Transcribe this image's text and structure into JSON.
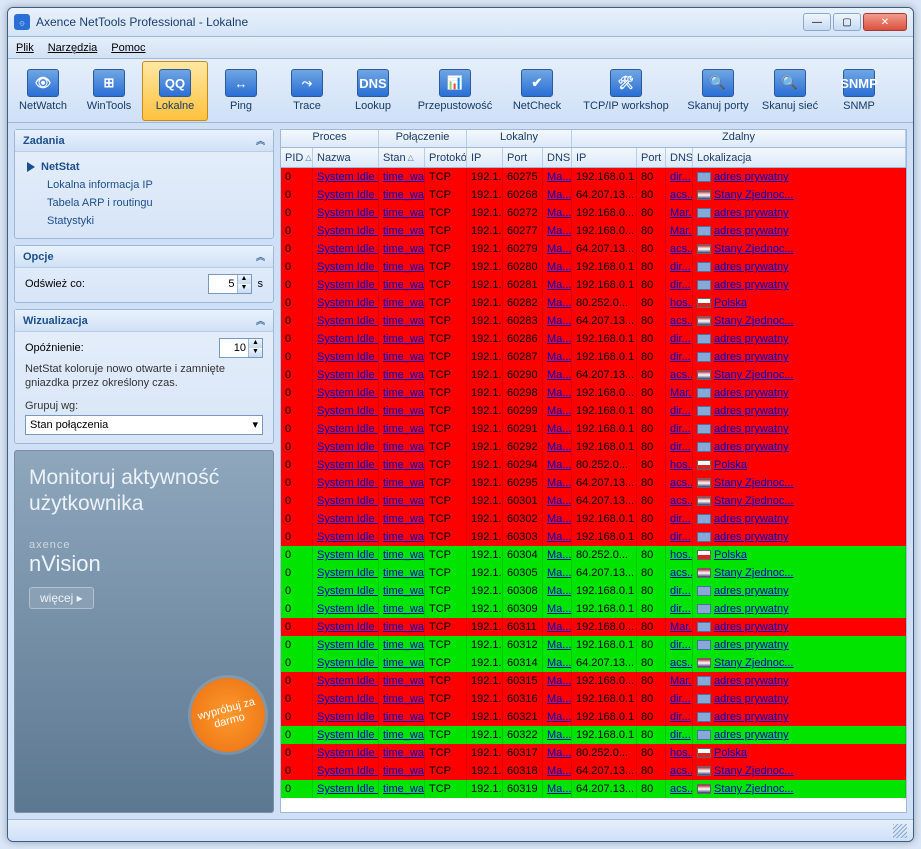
{
  "window_title": "Axence NetTools Professional - Lokalne",
  "menu": [
    "Plik",
    "Narzędzia",
    "Pomoc"
  ],
  "toolbar": [
    {
      "label": "NetWatch",
      "icon": "👁"
    },
    {
      "label": "WinTools",
      "icon": "⊞"
    },
    {
      "label": "Lokalne",
      "icon": "QQ",
      "selected": true
    },
    {
      "label": "Ping",
      "icon": "↔"
    },
    {
      "label": "Trace",
      "icon": "⤳"
    },
    {
      "label": "Lookup",
      "icon": "DNS"
    },
    {
      "label": "Przepustowość",
      "icon": "📊",
      "wide": true
    },
    {
      "label": "NetCheck",
      "icon": "✔"
    },
    {
      "label": "TCP/IP workshop",
      "icon": "🛠",
      "wider": true
    },
    {
      "label": "Skanuj porty",
      "icon": "🔍",
      "nar": true
    },
    {
      "label": "Skanuj sieć",
      "icon": "🔍",
      "nar": true
    },
    {
      "label": "SNMP",
      "icon": "SNMP"
    }
  ],
  "panels": {
    "tasks": {
      "title": "Zadania",
      "items": [
        {
          "label": "NetStat",
          "selected": true
        },
        {
          "label": "Lokalna informacja IP"
        },
        {
          "label": "Tabela ARP i routingu"
        },
        {
          "label": "Statystyki"
        }
      ]
    },
    "options": {
      "title": "Opcje",
      "refresh_label": "Odśwież co:",
      "refresh_value": "5",
      "unit": "s"
    },
    "viz": {
      "title": "Wizualizacja",
      "delay_label": "Opóźnienie:",
      "delay_value": "10",
      "note": "NetStat koloruje nowo otwarte i zamnięte gniazdka przez określony czas.",
      "group_label": "Grupuj wg:",
      "group_value": "Stan połączenia"
    }
  },
  "promo": {
    "heading": "Monitoruj aktywność użytkownika",
    "brand_small": "axence",
    "brand": "nVision",
    "more": "więcej ▸",
    "burst": "wypróbuj za darmo"
  },
  "groups": [
    "Proces",
    "Połączenie",
    "Lokalny",
    "Zdalny"
  ],
  "columns": [
    "PID",
    "Nazwa",
    "Stan",
    "Protokó",
    "IP",
    "Port",
    "DNS",
    "IP",
    "Port",
    "DNS",
    "Lokalizacja"
  ],
  "loc": {
    "priv": "adres prywatny",
    "us": "Stany Zjednoc...",
    "pl": "Polska"
  },
  "rows": [
    {
      "c": "r",
      "port": "60275",
      "rip": "192.168.0.1",
      "rdns": "dir...",
      "loc": "priv"
    },
    {
      "c": "r",
      "port": "60268",
      "rip": "64.207.13...",
      "rdns": "acs...",
      "loc": "us"
    },
    {
      "c": "r",
      "port": "60272",
      "rip": "192.168.0...",
      "rdns": "Mar...",
      "loc": "priv"
    },
    {
      "c": "r",
      "port": "60277",
      "rip": "192.168.0...",
      "rdns": "Mar...",
      "loc": "priv"
    },
    {
      "c": "r",
      "port": "60279",
      "rip": "64.207.13...",
      "rdns": "acs...",
      "loc": "us"
    },
    {
      "c": "r",
      "port": "60280",
      "rip": "192.168.0.1",
      "rdns": "dir...",
      "loc": "priv"
    },
    {
      "c": "r",
      "port": "60281",
      "rip": "192.168.0.1",
      "rdns": "dir...",
      "loc": "priv"
    },
    {
      "c": "r",
      "port": "60282",
      "rip": "80.252.0...",
      "rdns": "hos...",
      "loc": "pl"
    },
    {
      "c": "r",
      "port": "60283",
      "rip": "64.207.13...",
      "rdns": "acs...",
      "loc": "us"
    },
    {
      "c": "r",
      "port": "60286",
      "rip": "192.168.0.1",
      "rdns": "dir...",
      "loc": "priv"
    },
    {
      "c": "r",
      "port": "60287",
      "rip": "192.168.0.1",
      "rdns": "dir...",
      "loc": "priv"
    },
    {
      "c": "r",
      "port": "60290",
      "rip": "64.207.13...",
      "rdns": "acs...",
      "loc": "us"
    },
    {
      "c": "r",
      "port": "60298",
      "rip": "192.168.0...",
      "rdns": "Mar...",
      "loc": "priv"
    },
    {
      "c": "r",
      "port": "60299",
      "rip": "192.168.0.1",
      "rdns": "dir...",
      "loc": "priv"
    },
    {
      "c": "r",
      "port": "60291",
      "rip": "192.168.0.1",
      "rdns": "dir...",
      "loc": "priv"
    },
    {
      "c": "r",
      "port": "60292",
      "rip": "192.168.0.1",
      "rdns": "dir...",
      "loc": "priv"
    },
    {
      "c": "r",
      "port": "60294",
      "rip": "80.252.0...",
      "rdns": "hos...",
      "loc": "pl"
    },
    {
      "c": "r",
      "port": "60295",
      "rip": "64.207.13...",
      "rdns": "acs...",
      "loc": "us"
    },
    {
      "c": "r",
      "port": "60301",
      "rip": "64.207.13...",
      "rdns": "acs...",
      "loc": "us"
    },
    {
      "c": "r",
      "port": "60302",
      "rip": "192.168.0.1",
      "rdns": "dir...",
      "loc": "priv"
    },
    {
      "c": "r",
      "port": "60303",
      "rip": "192.168.0.1",
      "rdns": "dir...",
      "loc": "priv"
    },
    {
      "c": "g",
      "port": "60304",
      "rip": "80.252.0...",
      "rdns": "hos...",
      "loc": "pl"
    },
    {
      "c": "g",
      "port": "60305",
      "rip": "64.207.13...",
      "rdns": "acs...",
      "loc": "us"
    },
    {
      "c": "g",
      "port": "60308",
      "rip": "192.168.0.1",
      "rdns": "dir...",
      "loc": "priv"
    },
    {
      "c": "g",
      "port": "60309",
      "rip": "192.168.0.1",
      "rdns": "dir...",
      "loc": "priv"
    },
    {
      "c": "r",
      "port": "60311",
      "rip": "192.168.0...",
      "rdns": "Mar...",
      "loc": "priv"
    },
    {
      "c": "g",
      "port": "60312",
      "rip": "192.168.0.1",
      "rdns": "dir...",
      "loc": "priv"
    },
    {
      "c": "g",
      "port": "60314",
      "rip": "64.207.13...",
      "rdns": "acs...",
      "loc": "us"
    },
    {
      "c": "r",
      "port": "60315",
      "rip": "192.168.0...",
      "rdns": "Mar...",
      "loc": "priv"
    },
    {
      "c": "r",
      "port": "60316",
      "rip": "192.168.0.1",
      "rdns": "dir...",
      "loc": "priv"
    },
    {
      "c": "r",
      "port": "60321",
      "rip": "192.168.0.1",
      "rdns": "dir...",
      "loc": "priv"
    },
    {
      "c": "g",
      "port": "60322",
      "rip": "192.168.0.1",
      "rdns": "dir...",
      "loc": "priv"
    },
    {
      "c": "r",
      "port": "60317",
      "rip": "80.252.0...",
      "rdns": "hos...",
      "loc": "pl"
    },
    {
      "c": "r",
      "port": "60318",
      "rip": "64.207.13...",
      "rdns": "acs...",
      "loc": "us"
    },
    {
      "c": "g",
      "port": "60319",
      "rip": "64.207.13...",
      "rdns": "acs...",
      "loc": "us"
    }
  ],
  "row_defaults": {
    "pid": "0",
    "name": "System Idle ...",
    "state": "time_wait",
    "proto": "TCP",
    "lip": "192.1...",
    "ldns": "Ma...",
    "rport": "80"
  }
}
